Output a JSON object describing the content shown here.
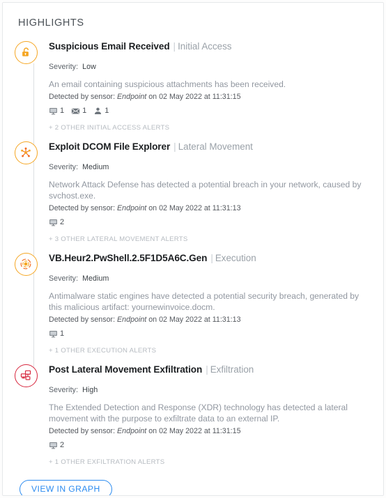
{
  "panel": {
    "title": "HIGHLIGHTS"
  },
  "colors": {
    "accent_orange": "#f5a623",
    "accent_red": "#d7263d",
    "link_blue": "#2d8cf0",
    "title_text": "#1c1f22",
    "muted_text": "#9197a0"
  },
  "labels": {
    "severity_label": "Severity:",
    "separator": "|"
  },
  "alerts": [
    {
      "icon": "unlocked-padlock-icon",
      "icon_color": "#f5a623",
      "name": "Suspicious Email Received",
      "tactic": "Initial Access",
      "severity": "Low",
      "description": "An email containing suspicious attachments has been received.",
      "detected_prefix": "Detected by sensor:",
      "sensor": "Endpoint",
      "detected_suffix": "on 02 May 2022 at 11:31:15",
      "counts": [
        {
          "icon": "monitor-icon",
          "value": "1"
        },
        {
          "icon": "envelope-icon",
          "value": "1"
        },
        {
          "icon": "user-icon",
          "value": "1"
        }
      ],
      "more_alerts": "+ 2 OTHER INITIAL ACCESS ALERTS"
    },
    {
      "icon": "network-node-icon",
      "icon_color": "#f5a623",
      "name": "Exploit DCOM File Explorer",
      "tactic": "Lateral Movement",
      "severity": "Medium",
      "description": "Network Attack Defense has detected a potential breach in your network, caused by svchost.exe.",
      "detected_prefix": "Detected by sensor:",
      "sensor": "Endpoint",
      "detected_suffix": "on 02 May 2022 at 11:31:13",
      "counts": [
        {
          "icon": "monitor-icon",
          "value": "2"
        }
      ],
      "more_alerts": "+ 3 OTHER LATERAL MOVEMENT ALERTS"
    },
    {
      "icon": "target-radial-icon",
      "icon_color": "#f5a623",
      "name": "VB.Heur2.PwShell.2.5F1D5A6C.Gen",
      "tactic": "Execution",
      "severity": "Medium",
      "description": "Antimalware static engines have detected a potential security breach, generated by this malicious artifact: yournewinvoice.docm.",
      "detected_prefix": "Detected by sensor:",
      "sensor": "Endpoint",
      "detected_suffix": "on 02 May 2022 at 11:31:13",
      "counts": [
        {
          "icon": "monitor-icon",
          "value": "1"
        }
      ],
      "more_alerts": "+ 1 OTHER EXECUTION ALERTS"
    },
    {
      "icon": "connected-screens-icon",
      "icon_color": "#d7263d",
      "name": "Post Lateral Movement Exfiltration",
      "tactic": "Exfiltration",
      "severity": "High",
      "description": "The Extended Detection and Response (XDR) technology has detected a lateral movement with the purpose to exfiltrate data to an external IP.",
      "detected_prefix": "Detected by sensor:",
      "sensor": "Endpoint",
      "detected_suffix": "on 02 May 2022 at 11:31:15",
      "counts": [
        {
          "icon": "monitor-icon",
          "value": "2"
        }
      ],
      "more_alerts": "+ 1 OTHER EXFILTRATION ALERTS"
    }
  ],
  "footer": {
    "view_in_graph": "VIEW IN GRAPH"
  }
}
